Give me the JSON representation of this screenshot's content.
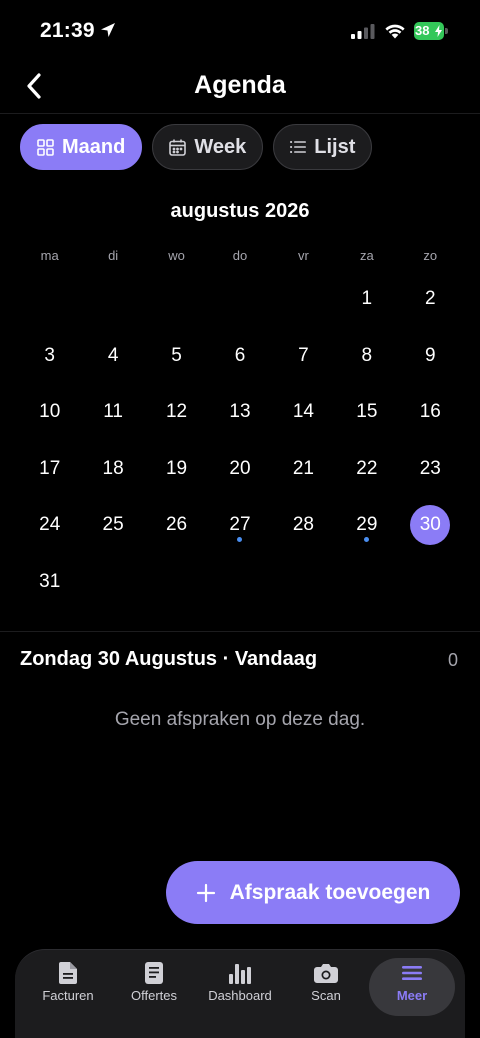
{
  "status": {
    "time": "21:39",
    "battery": "38"
  },
  "header": {
    "title": "Agenda"
  },
  "view_tabs": [
    {
      "label": "Maand",
      "icon": "grid-icon",
      "active": true
    },
    {
      "label": "Week",
      "icon": "calendar-icon",
      "active": false
    },
    {
      "label": "Lijst",
      "icon": "list-icon",
      "active": false
    }
  ],
  "calendar": {
    "month_label": "augustus 2026",
    "weekdays": [
      "ma",
      "di",
      "wo",
      "do",
      "vr",
      "za",
      "zo"
    ],
    "leading_blanks": 5,
    "days": [
      1,
      2,
      3,
      4,
      5,
      6,
      7,
      8,
      9,
      10,
      11,
      12,
      13,
      14,
      15,
      16,
      17,
      18,
      19,
      20,
      21,
      22,
      23,
      24,
      25,
      26,
      27,
      28,
      29,
      30,
      31
    ],
    "today": 30,
    "event_days": [
      27,
      29
    ],
    "colors": {
      "accent": "#8b7cf6",
      "event_dot": "#4a8ef0"
    }
  },
  "selected_day": {
    "heading": "Zondag 30 Augustus · Vandaag",
    "count": "0",
    "empty_message": "Geen afspraken op deze dag."
  },
  "add_button": {
    "label": "Afspraak toevoegen"
  },
  "bottom_nav": [
    {
      "label": "Facturen",
      "icon": "document-icon",
      "active": false
    },
    {
      "label": "Offertes",
      "icon": "file-lines-icon",
      "active": false
    },
    {
      "label": "Dashboard",
      "icon": "bar-chart-icon",
      "active": false
    },
    {
      "label": "Scan",
      "icon": "camera-icon",
      "active": false
    },
    {
      "label": "Meer",
      "icon": "menu-icon",
      "active": true
    }
  ]
}
